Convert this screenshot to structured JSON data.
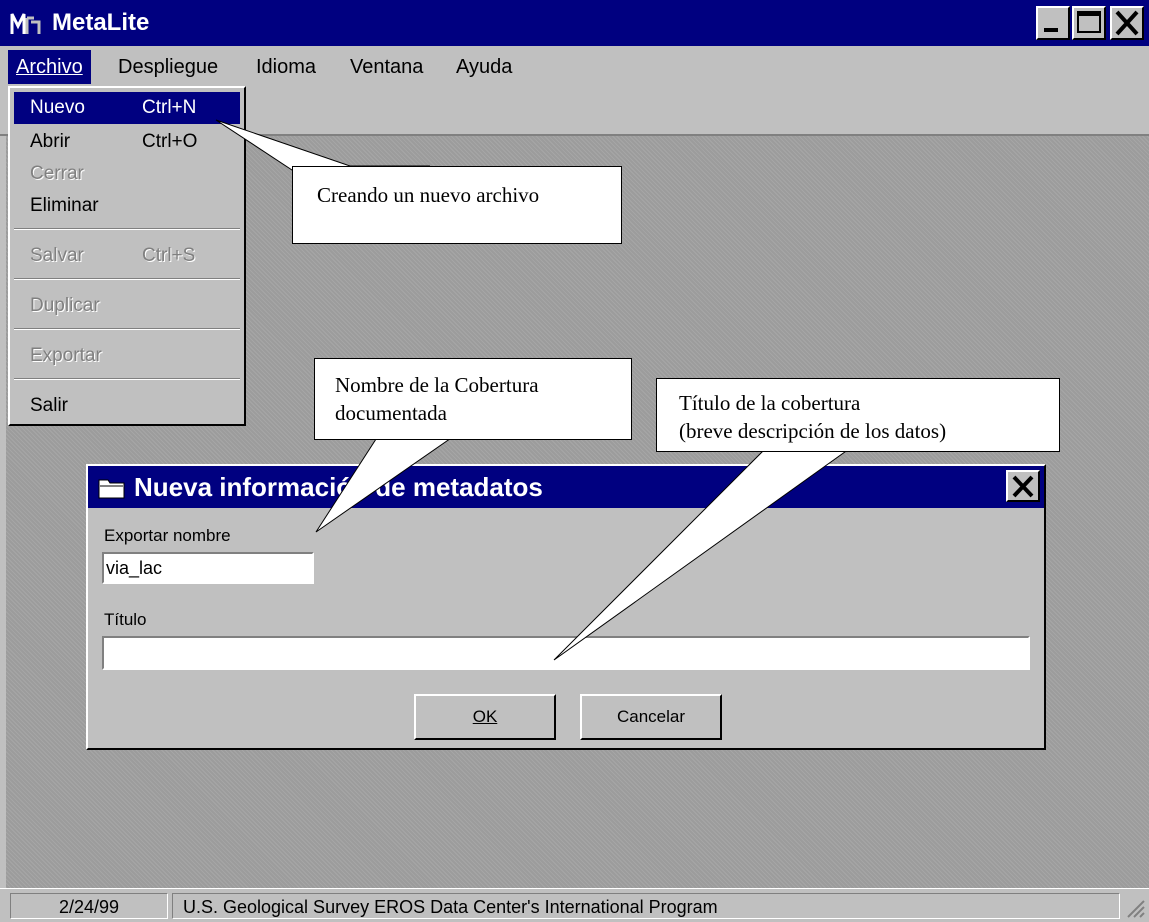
{
  "app": {
    "title": "MetaLite",
    "window_controls": {
      "minimize_icon": "minimize-icon",
      "maximize_icon": "maximize-icon",
      "close_icon": "close-icon"
    }
  },
  "menubar": {
    "items": [
      {
        "label": "Archivo"
      },
      {
        "label": "Despliegue"
      },
      {
        "label": "Idioma"
      },
      {
        "label": "Ventana"
      },
      {
        "label": "Ayuda"
      }
    ]
  },
  "file_menu": {
    "items": [
      {
        "label": "Nuevo",
        "shortcut": "Ctrl+N"
      },
      {
        "label": "Abrir",
        "shortcut": "Ctrl+O"
      },
      {
        "label": "Cerrar",
        "shortcut": ""
      },
      {
        "label": "Eliminar",
        "shortcut": ""
      },
      {
        "label": "Salvar",
        "shortcut": "Ctrl+S"
      },
      {
        "label": "Duplicar",
        "shortcut": ""
      },
      {
        "label": "Exportar",
        "shortcut": ""
      },
      {
        "label": "Salir",
        "shortcut": ""
      }
    ]
  },
  "callouts": {
    "new_file": "Creando un nuevo archivo",
    "coverage_name_line1": "Nombre de la Cobertura",
    "coverage_name_line2": "documentada",
    "coverage_title_line1": "Título de la cobertura",
    "coverage_title_line2": "(breve descripción de los datos)"
  },
  "dialog": {
    "title": "Nueva información de metadatos",
    "export_label": "Exportar nombre",
    "export_value": "via_lac",
    "title_label": "Título",
    "title_value": "",
    "ok_label": "OK",
    "cancel_label": "Cancelar"
  },
  "statusbar": {
    "date": "2/24/99",
    "message": "U.S. Geological Survey EROS Data Center's International Program"
  },
  "colors": {
    "title_bar": "#000080",
    "face": "#c0c0c0",
    "workspace": "#9c9c9c"
  }
}
